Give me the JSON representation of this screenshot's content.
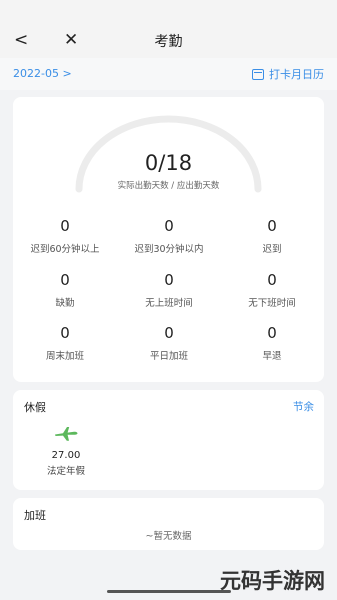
{
  "nav": {
    "back": "<",
    "close": "✕",
    "title": "考勤"
  },
  "subbar": {
    "month": "2022-05 >",
    "calendar_link": "打卡月日历"
  },
  "summary": {
    "actual_days": 0,
    "required_days": 18,
    "ratio_text": "0/18",
    "caption": "实际出勤天数 / 应出勤天数"
  },
  "stats": [
    {
      "value": "0",
      "label": "迟到60分钟以上"
    },
    {
      "value": "0",
      "label": "迟到30分钟以内"
    },
    {
      "value": "0",
      "label": "迟到"
    },
    {
      "value": "0",
      "label": "缺勤"
    },
    {
      "value": "0",
      "label": "无上班时间"
    },
    {
      "value": "0",
      "label": "无下班时间"
    },
    {
      "value": "0",
      "label": "周末加班"
    },
    {
      "value": "0",
      "label": "平日加班"
    },
    {
      "value": "0",
      "label": "早退"
    }
  ],
  "leave": {
    "title": "休假",
    "link": "节余",
    "items": [
      {
        "icon": "airplane-icon",
        "value": "27.00",
        "label": "法定年假"
      }
    ]
  },
  "overtime": {
    "title": "加班",
    "empty_text": "~暂无数据"
  },
  "watermark": "元码手游网",
  "colors": {
    "accent": "#3a8ee6",
    "plane": "#5cb85c",
    "gauge_track": "#ececec"
  }
}
